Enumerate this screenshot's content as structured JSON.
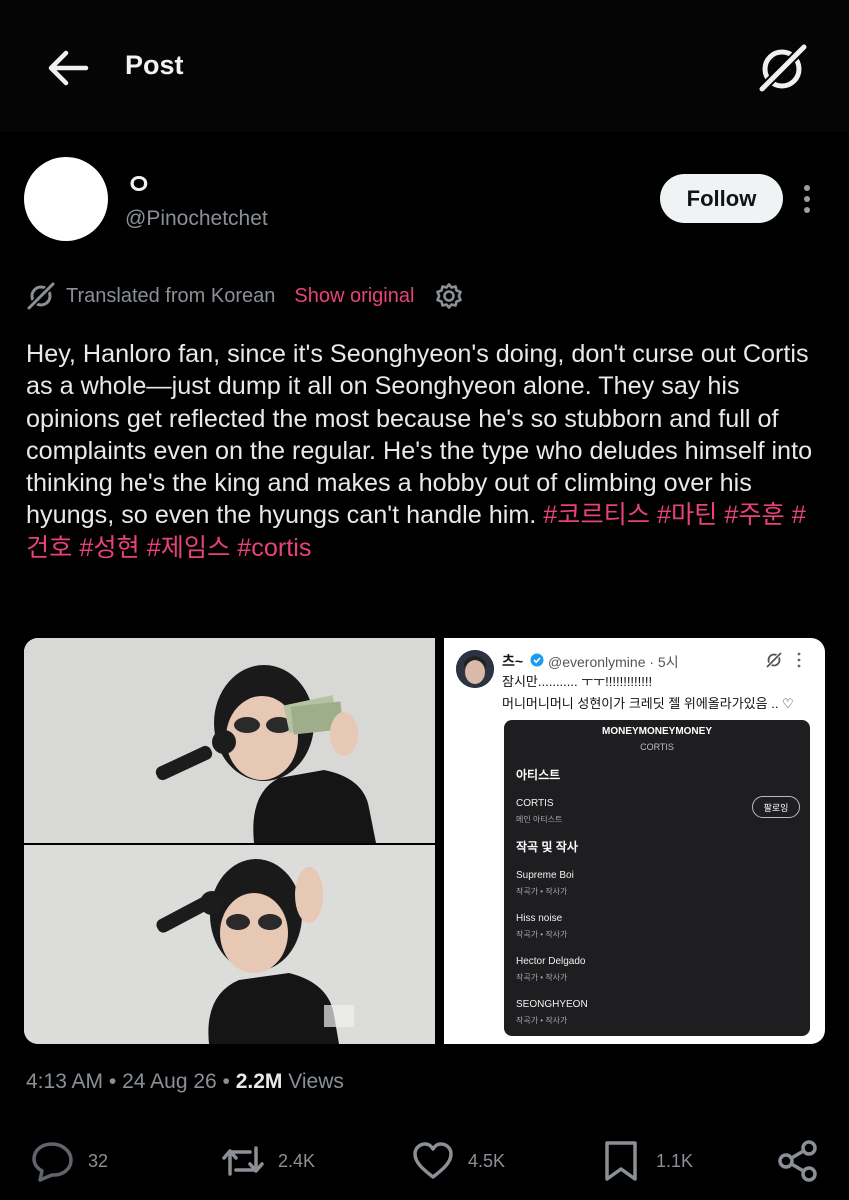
{
  "header": {
    "title": "Post",
    "back_icon": "arrow-left-icon",
    "grok_icon": "grok-icon"
  },
  "author": {
    "display_name": "ㅇ",
    "handle": "@Pinochetchet",
    "follow_label": "Follow",
    "more_icon": "more-vertical-icon"
  },
  "translation": {
    "label": "Translated from Korean",
    "show_original": "Show original",
    "accent_color": "#e8427a"
  },
  "post": {
    "text": "Hey, Hanloro fan, since it's Seonghyeon's doing, don't curse out Cortis as a whole—just dump it all on Seonghyeon alone. They say his opinions get reflected the most because he's so stubborn and full of complaints even on the regular. He's the type who deludes himself into thinking he's the king and makes a hobby out of climbing over his hyungs, so even the hyungs can't handle him.",
    "hashtags": [
      "#코르티스",
      "#마틴",
      "#주훈",
      "#건호",
      "#성현",
      "#제임스",
      "#cortis"
    ]
  },
  "quoted_screenshot": {
    "name": "츠~",
    "handle_time": "@everonlymine · 5시",
    "line1": "잠시만........... ㅜㅜ!!!!!!!!!!!!!",
    "line2": "머니머니머니 성현이가 크레딧 젤 위에올라가있음 .. ♡",
    "card": {
      "title": "MONEYMONEYMONEY",
      "subtitle": "CORTIS",
      "artist_section": "아티스트",
      "artist_name": "CORTIS",
      "artist_role": "메인 아티스트",
      "follow_label": "팔로잉",
      "credits_section": "작곡 및 작사",
      "credits": [
        {
          "name": "Supreme Boi",
          "role": "작곡가 • 작사가"
        },
        {
          "name": "Hiss noise",
          "role": "작곡가 • 작사가"
        },
        {
          "name": "Hector Delgado",
          "role": "작곡가 • 작사가"
        },
        {
          "name": "SEONGHYEON",
          "role": "작곡가 • 작사가"
        }
      ]
    }
  },
  "meta": {
    "time": "4:13 AM",
    "date": "24 Aug 26",
    "views_count": "2.2M",
    "views_label": "Views"
  },
  "actions": {
    "replies": "32",
    "reposts": "2.4K",
    "likes": "4.5K",
    "bookmarks": "1.1K"
  }
}
